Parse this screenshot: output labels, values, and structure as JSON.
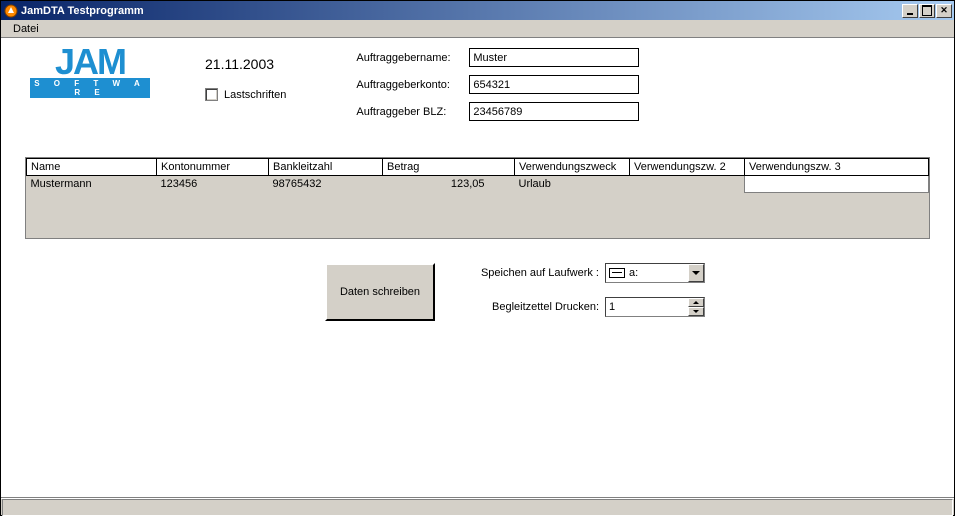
{
  "window": {
    "title": "JamDTA Testprogramm"
  },
  "menu": {
    "file": "Datei"
  },
  "logo": {
    "main": "JAM",
    "sub": "S O F T W A R E"
  },
  "date": "21.11.2003",
  "lastschriften_label": "Lastschriften",
  "form": {
    "name_label": "Auftraggebername:",
    "name_value": "Muster",
    "konto_label": "Auftraggeberkonto:",
    "konto_value": "654321",
    "blz_label": "Auftraggeber BLZ:",
    "blz_value": "23456789"
  },
  "grid": {
    "headers": [
      "Name",
      "Kontonummer",
      "Bankleitzahl",
      "Betrag",
      "Verwendungszweck",
      "Verwendungszw. 2",
      "Verwendungszw. 3"
    ],
    "row": [
      "Mustermann",
      "123456",
      "98765432",
      "123,05",
      "Urlaub",
      "",
      ""
    ]
  },
  "button_write": "Daten schreiben",
  "controls": {
    "drive_label": "Speichen auf Laufwerk :",
    "drive_value": "a:",
    "print_label": "Begleitzettel Drucken:",
    "print_value": "1"
  }
}
